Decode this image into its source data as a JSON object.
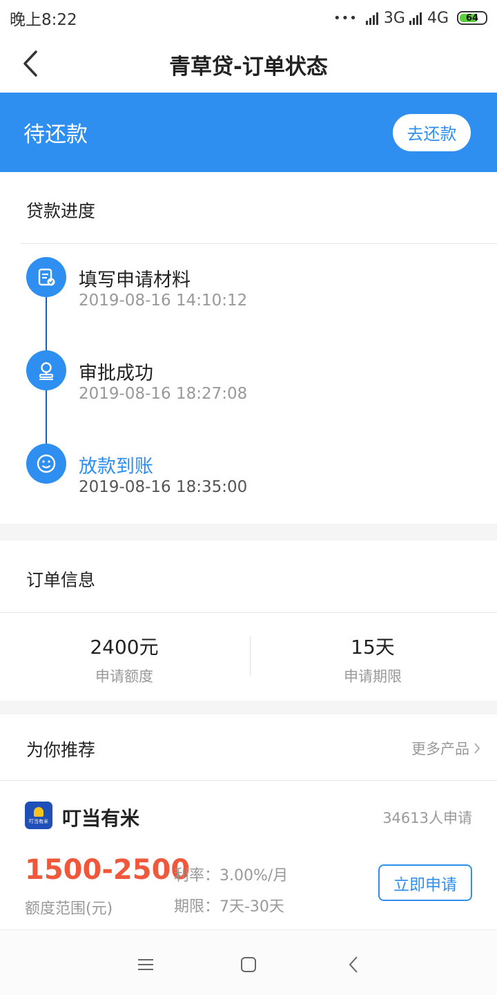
{
  "status_bar": {
    "time": "晚上8:22",
    "dots": "•••",
    "network1": "3G",
    "network2": "4G",
    "battery": "64"
  },
  "nav": {
    "title": "青草贷-订单状态"
  },
  "banner": {
    "status": "待还款",
    "repay_button": "去还款",
    "color": "#2e8ff0"
  },
  "progress": {
    "title": "贷款进度",
    "steps": [
      {
        "label": "填写申请材料",
        "time": "2019-08-16 14:10:12",
        "icon": "document-check-icon"
      },
      {
        "label": "审批成功",
        "time": "2019-08-16 18:27:08",
        "icon": "stamp-icon"
      },
      {
        "label": "放款到账",
        "time": "2019-08-16 18:35:00",
        "icon": "smile-icon"
      }
    ]
  },
  "order_info": {
    "title": "订单信息",
    "amount_value": "2400元",
    "amount_label": "申请额度",
    "term_value": "15天",
    "term_label": "申请期限"
  },
  "recommend": {
    "title": "为你推荐",
    "more_link": "更多产品",
    "product": {
      "name": "叮当有米",
      "logo_text": "叮当有米",
      "applicants": "34613人申请",
      "amount_range": "1500-2500",
      "amount_label": "额度范围(元)",
      "rate": "利率：3.00%/月",
      "term": "期限：7天-30天",
      "apply_button": "立即申请"
    }
  },
  "system_nav": {
    "icons": [
      "menu-icon",
      "home-icon",
      "back-icon"
    ]
  }
}
